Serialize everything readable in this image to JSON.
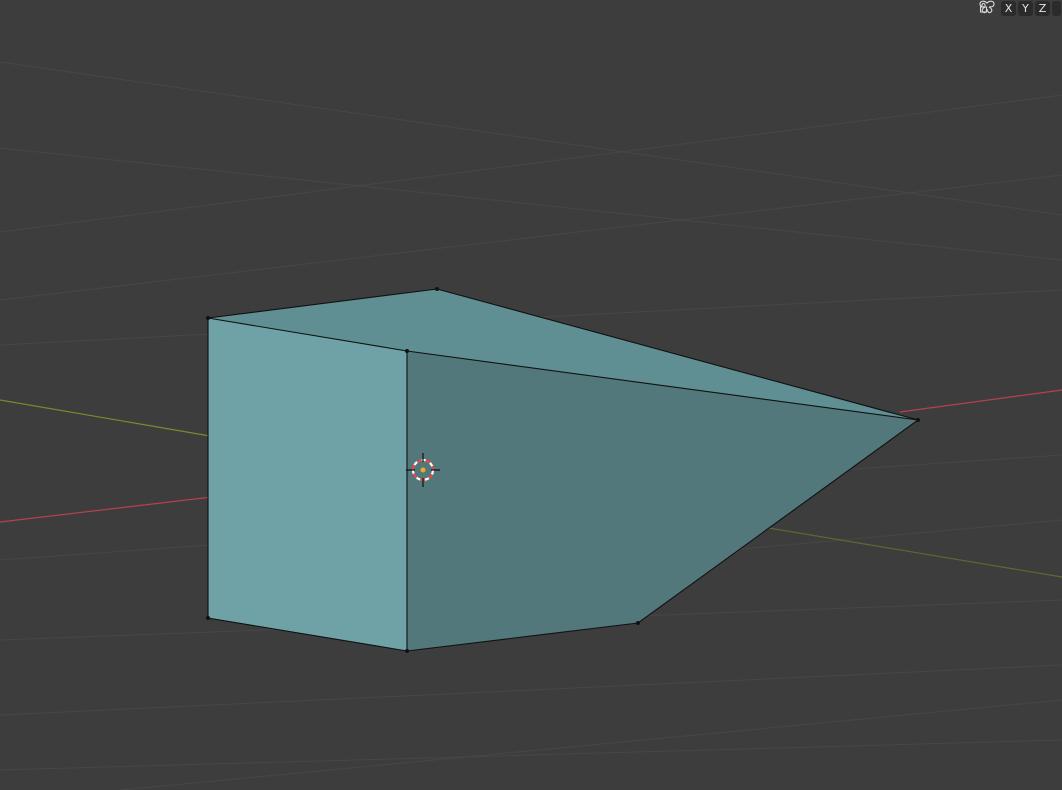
{
  "viewport": {
    "background": "#3d3d3d",
    "grid_color": "#474747",
    "x_axis_color": "#b5424f",
    "y_axis_color": "#7b8a2a",
    "object": {
      "front_face_color": "#6fa2a6",
      "side_face_color": "#52787c",
      "top_face_color": "#5f8f93",
      "edge_color": "#111111"
    },
    "cursor": {
      "icon": "3d-cursor-icon",
      "ring_colors": [
        "#e64747",
        "#ffffff"
      ]
    }
  },
  "axis_toolbar": {
    "mirror_icon": "mirror-butterfly-icon",
    "x_label": "X",
    "y_label": "Y",
    "z_label": "Z",
    "lock_icon": "lock-icon"
  }
}
